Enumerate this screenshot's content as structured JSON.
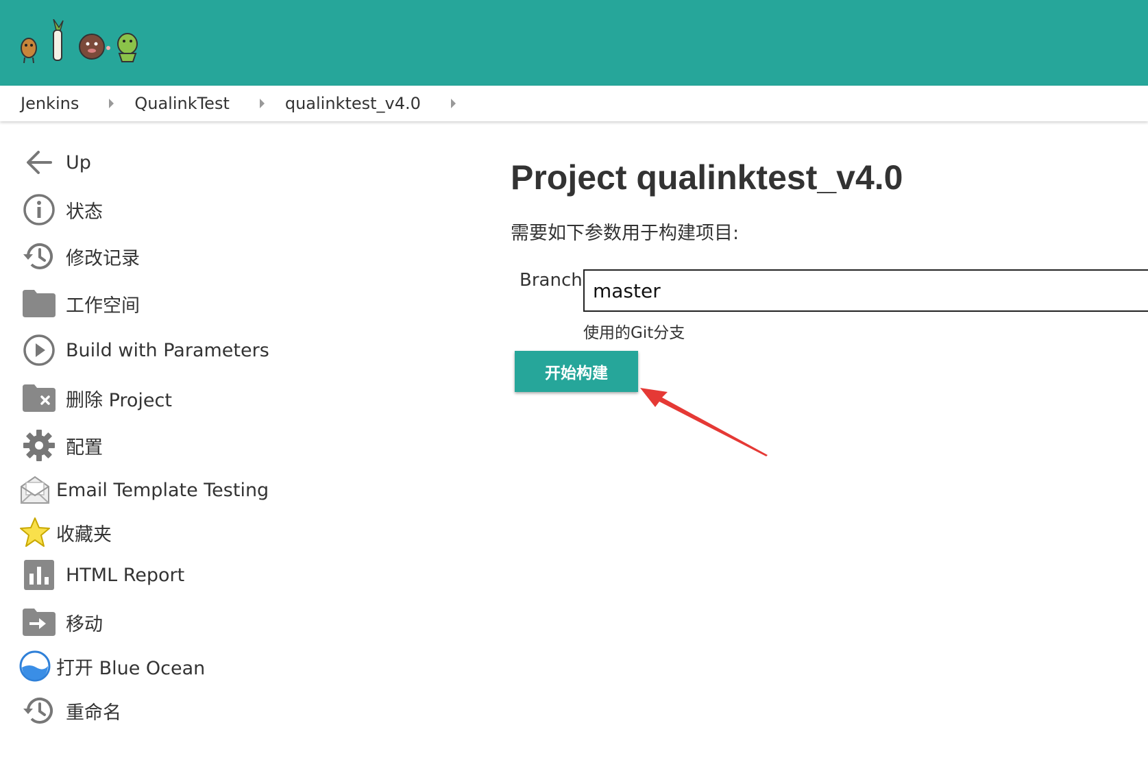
{
  "breadcrumbs": [
    {
      "label": "Jenkins"
    },
    {
      "label": "QualinkTest"
    },
    {
      "label": "qualinktest_v4.0"
    }
  ],
  "sidebar": {
    "items": [
      {
        "label": "Up",
        "icon": "arrow-left-icon"
      },
      {
        "label": "状态",
        "icon": "info-icon"
      },
      {
        "label": "修改记录",
        "icon": "history-icon"
      },
      {
        "label": "工作空间",
        "icon": "folder-icon"
      },
      {
        "label": "Build with Parameters",
        "icon": "play-circle-icon"
      },
      {
        "label": "删除 Project",
        "icon": "folder-delete-icon"
      },
      {
        "label": "配置",
        "icon": "gear-icon"
      },
      {
        "label": "Email Template Testing",
        "icon": "envelope-icon"
      },
      {
        "label": "收藏夹",
        "icon": "star-icon"
      },
      {
        "label": "HTML Report",
        "icon": "bar-chart-icon"
      },
      {
        "label": "移动",
        "icon": "folder-move-icon"
      },
      {
        "label": "打开 Blue Ocean",
        "icon": "blue-ocean-icon"
      },
      {
        "label": "重命名",
        "icon": "history-icon"
      }
    ]
  },
  "main": {
    "title": "Project qualinktest_v4.0",
    "description": "需要如下参数用于构建项目:",
    "param": {
      "label": "Branch",
      "value": "master",
      "help": "使用的Git分支"
    },
    "build_button": "开始构建"
  },
  "colors": {
    "header": "#26a69a",
    "annotation_arrow": "#e53935"
  }
}
